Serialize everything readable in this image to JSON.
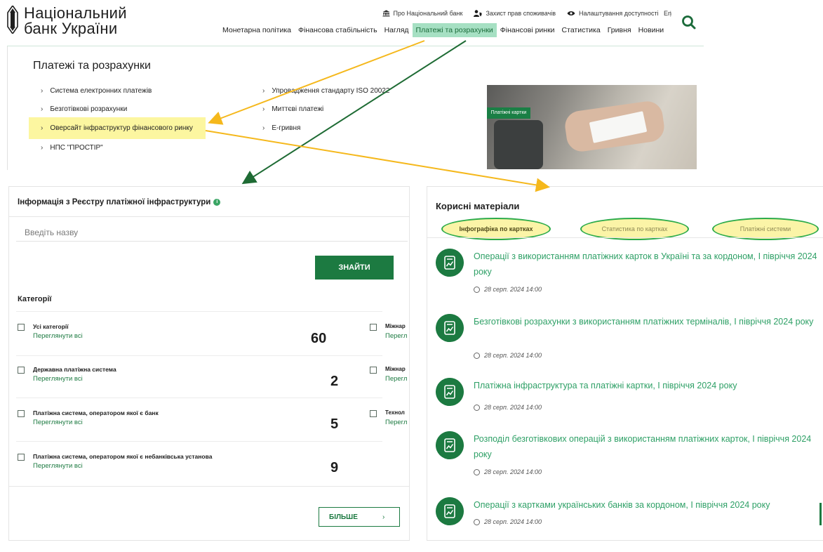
{
  "header": {
    "logo_line1": "Національний",
    "logo_line2": "банк України",
    "utility_links": [
      {
        "icon": "bank-building-icon",
        "label": "Про Національний банк"
      },
      {
        "icon": "person-shield-icon",
        "label": "Захист прав споживачів"
      },
      {
        "icon": "eye-icon",
        "label": "Налаштування доступності"
      }
    ],
    "lang": "En",
    "nav": [
      "Монетарна політика",
      "Фінансова стабільність",
      "Нагляд",
      "Платежі та розрахунки",
      "Фінансові ринки",
      "Статистика",
      "Гривня",
      "Новини"
    ],
    "active_nav_index": 3,
    "search_icon": "search-icon"
  },
  "dropdown": {
    "title": "Платежі та розрахунки",
    "col1": [
      "Система електронних платежів",
      "Безготівкові розрахунки",
      "Оверсайт інфраструктур фінансового ринку",
      "НПС \"ПРОСТІР\""
    ],
    "col2": [
      "Упровадження стандарту ISO 20022",
      "Миттєві платежі",
      "Е-гривня"
    ],
    "promo_tag": "Платіжні картки",
    "highlight_color": "#fcf6a0"
  },
  "registry": {
    "title": "Інформація з Реєстру платіжної інфраструктури",
    "info_icon": "i",
    "search_placeholder": "Введіть назву",
    "find_button": "ЗНАЙТИ",
    "categories_title": "Категорії",
    "view_all": "Переглянути всі",
    "left_categories": [
      {
        "name": "Усі категорії",
        "count": "60"
      },
      {
        "name": "Державна платіжна система",
        "count": "2"
      },
      {
        "name": "Платіжна система, оператором якої є банк",
        "count": "5"
      },
      {
        "name": "Платіжна система, оператором якої є небанківська установа",
        "count": "9"
      }
    ],
    "right_categories": [
      {
        "name": "Міжнар",
        "link": "Перегл"
      },
      {
        "name": "Міжнар",
        "link": "Перегл"
      },
      {
        "name": "Технол",
        "link": "Перегл"
      }
    ],
    "more_button": "БІЛЬШЕ",
    "more_arrow": "›"
  },
  "materials": {
    "title": "Корисні матеріали",
    "tabs": [
      "Інфографіка по картках",
      "Статистика по картках",
      "Платіжні системи"
    ],
    "active_tab_index": 0,
    "articles": [
      {
        "title": "Операції з використанням платіжних карток в Україні та за кордоном, І півріччя 2024 року",
        "date": "28 серп. 2024 14:00"
      },
      {
        "title": "Безготівкові розрахунки з використанням платіжних терміналів, І півріччя 2024 року",
        "date": "28 серп. 2024 14:00"
      },
      {
        "title": "Платіжна інфраструктура та платіжні картки, І півріччя 2024 року",
        "date": "28 серп. 2024 14:00"
      },
      {
        "title": "Розподіл безготівкових операцій з використанням платіжних карток, І півріччя 2024 року",
        "date": "28 серп. 2024 14:00"
      },
      {
        "title": "Операції з картками українських банків за кордоном, І півріччя 2024 року",
        "date": "28 серп. 2024 14:00"
      }
    ],
    "article_icon": "document-chart-icon"
  },
  "colors": {
    "brand_green": "#1c7a41",
    "link_green": "#2ea066",
    "annotation_yellow_arrow": "#f5b81c",
    "annotation_green_arrow": "#1e6b34",
    "active_nav_bg": "#a6e0c3"
  }
}
